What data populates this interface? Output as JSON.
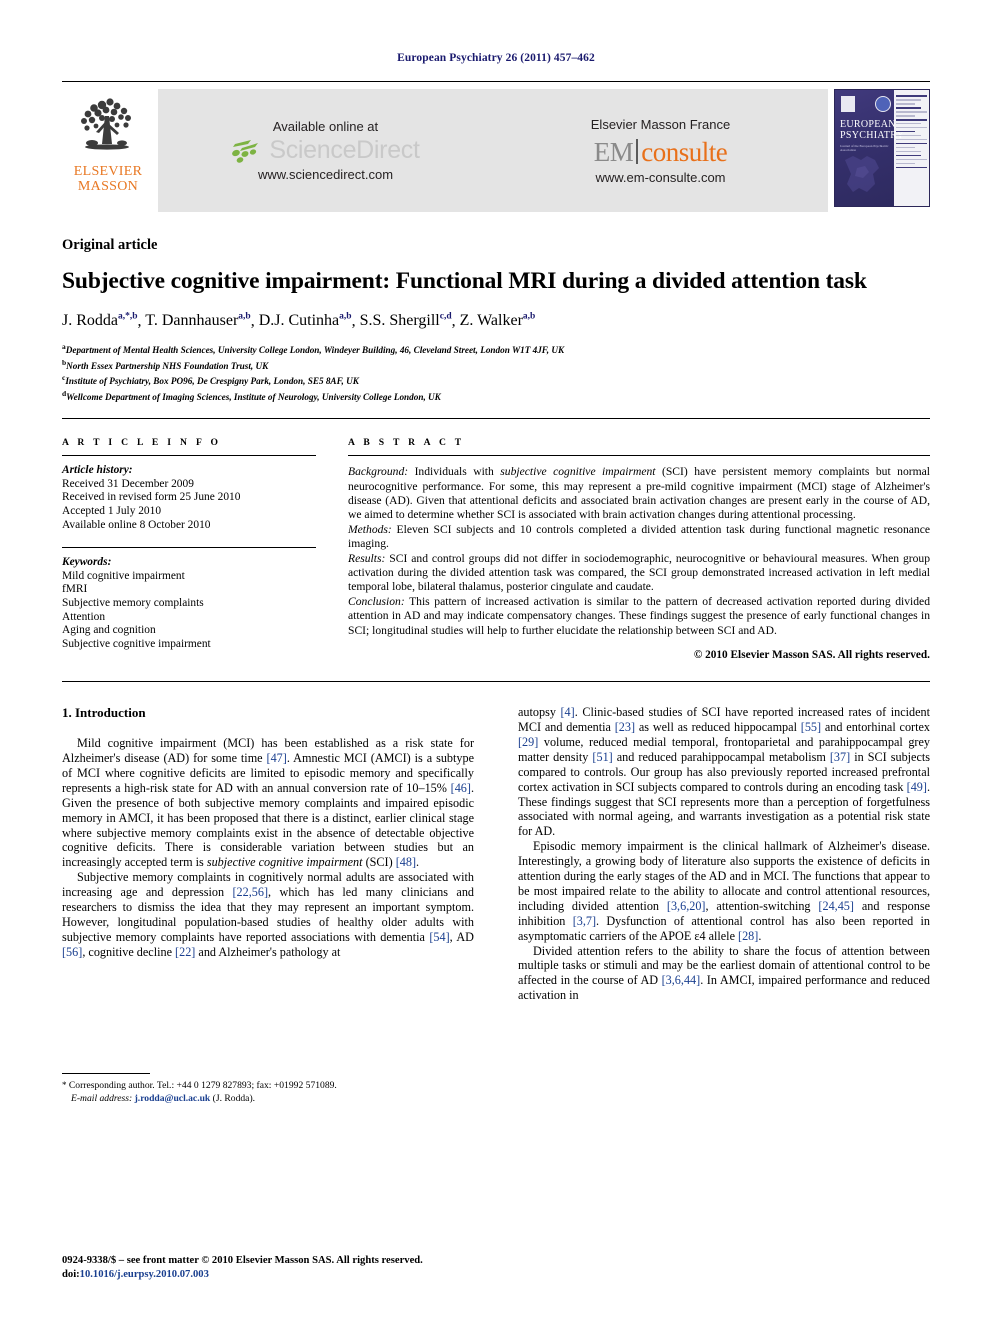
{
  "running_head": "European Psychiatry 26 (2011) 457–462",
  "masthead": {
    "elsevier": {
      "line1": "ELSEVIER",
      "line2": "MASSON",
      "logo_color": "#E87722",
      "icon": "tree-icon"
    },
    "sciencedirect": {
      "available_text": "Available online at",
      "wordmark": "ScienceDirect",
      "url": "www.sciencedirect.com",
      "accent_color": "#7DB343"
    },
    "emconsulte": {
      "publisher": "Elsevier Masson France",
      "wordmark_left": "EM",
      "wordmark_right": "consulte",
      "url": "www.em-consulte.com",
      "accent_color": "#E8701A"
    },
    "cover": {
      "title_line1": "EUROPEAN",
      "title_line2": "PSYCHIATRY",
      "subtitle": "Journal of the European Psychiatric Association",
      "background_color": "#3a3470"
    }
  },
  "article": {
    "type": "Original article",
    "title": "Subjective cognitive impairment: Functional MRI during a divided attention task",
    "authors": [
      {
        "name": "J. Rodda",
        "sup": "a,*,b"
      },
      {
        "name": "T. Dannhauser",
        "sup": "a,b"
      },
      {
        "name": "D.J. Cutinha",
        "sup": "a,b"
      },
      {
        "name": "S.S. Shergill",
        "sup": "c,d"
      },
      {
        "name": "Z. Walker",
        "sup": "a,b"
      }
    ],
    "affiliations": [
      {
        "mark": "a",
        "text": "Department of Mental Health Sciences, University College London, Windeyer Building, 46, Cleveland Street, London W1T 4JF, UK"
      },
      {
        "mark": "b",
        "text": "North Essex Partnership NHS Foundation Trust, UK"
      },
      {
        "mark": "c",
        "text": "Institute of Psychiatry, Box PO96, De Crespigny Park, London, SE5 8AF, UK"
      },
      {
        "mark": "d",
        "text": "Wellcome Department of Imaging Sciences, Institute of Neurology, University College London, UK"
      }
    ]
  },
  "article_info": {
    "heading": "A R T I C L E   I N F O",
    "history_label": "Article history:",
    "history": [
      "Received 31 December 2009",
      "Received in revised form 25 June 2010",
      "Accepted 1 July 2010",
      "Available online 8 October 2010"
    ],
    "keywords_label": "Keywords:",
    "keywords": [
      "Mild cognitive impairment",
      "fMRI",
      "Subjective memory complaints",
      "Attention",
      "Aging and cognition",
      "Subjective cognitive impairment"
    ]
  },
  "abstract": {
    "heading": "A B S T R A C T",
    "sections": [
      {
        "label": "Background:",
        "text_before_italic": " Individuals with ",
        "italic": "subjective cognitive impairment",
        "text_after_italic": " (SCI) have persistent memory complaints but normal neurocognitive performance. For some, this may represent a pre-mild cognitive impairment (MCI) stage of Alzheimer's disease (AD). Given that attentional deficits and associated brain activation changes are present early in the course of AD, we aimed to determine whether SCI is associated with brain activation changes during attentional processing."
      },
      {
        "label": "Methods:",
        "text": " Eleven SCI subjects and 10 controls completed a divided attention task during functional magnetic resonance imaging."
      },
      {
        "label": "Results:",
        "text": " SCI and control groups did not differ in sociodemographic, neurocognitive or behavioural measures. When group activation during the divided attention task was compared, the SCI group demonstrated increased activation in left medial temporal lobe, bilateral thalamus, posterior cingulate and caudate."
      },
      {
        "label": "Conclusion:",
        "text": " This pattern of increased activation is similar to the pattern of decreased activation reported during divided attention in AD and may indicate compensatory changes. These findings suggest the presence of early functional changes in SCI; longitudinal studies will help to further elucidate the relationship between SCI and AD."
      }
    ],
    "copyright": "© 2010 Elsevier Masson SAS. All rights reserved."
  },
  "body": {
    "section_number_title": "1. Introduction",
    "left_paragraphs": [
      "Mild cognitive impairment (MCI) has been established as a risk state for Alzheimer's disease (AD) for some time [47]. Amnestic MCI (AMCI) is a subtype of MCI where cognitive deficits are limited to episodic memory and specifically represents a high-risk state for AD with an annual conversion rate of 10–15% [46]. Given the presence of both subjective memory complaints and impaired episodic memory in AMCI, it has been proposed that there is a distinct, earlier clinical stage where subjective memory complaints exist in the absence of detectable objective cognitive deficits. There is considerable variation between studies but an increasingly accepted term is subjective cognitive impairment (SCI) [48].",
      "Subjective memory complaints in cognitively normal adults are associated with increasing age and depression [22,56], which has led many clinicians and researchers to dismiss the idea that they may represent an important symptom. However, longitudinal population-based studies of healthy older adults with subjective memory complaints have reported associations with dementia [54], AD [56], cognitive decline [22] and Alzheimer's pathology at"
    ],
    "right_paragraphs": [
      "autopsy [4]. Clinic-based studies of SCI have reported increased rates of incident MCI and dementia [23] as well as reduced hippocampal [55] and entorhinal cortex [29] volume, reduced medial temporal, frontoparietal and parahippocampal grey matter density [51] and reduced parahippocampal metabolism [37] in SCI subjects compared to controls. Our group has also previously reported increased prefrontal cortex activation in SCI subjects compared to controls during an encoding task [49]. These findings suggest that SCI represents more than a perception of forgetfulness associated with normal ageing, and warrants investigation as a potential risk state for AD.",
      "Episodic memory impairment is the clinical hallmark of Alzheimer's disease. Interestingly, a growing body of literature also supports the existence of deficits in attention during the early stages of the AD and in MCI. The functions that appear to be most impaired relate to the ability to allocate and control attentional resources, including divided attention [3,6,20], attention-switching [24,45] and response inhibition [3,7]. Dysfunction of attentional control has also been reported in asymptomatic carriers of the APOE ε4 allele [28].",
      "Divided attention refers to the ability to share the focus of attention between multiple tasks or stimuli and may be the earliest domain of attentional control to be affected in the course of AD [3,6,44]. In AMCI, impaired performance and reduced activation in"
    ]
  },
  "footnote": {
    "marker": "*",
    "text": "Corresponding author. Tel.: +44 0 1279 827893; fax: +01992 571089.",
    "email_label": "E-mail address:",
    "email": "j.rodda@ucl.ac.uk",
    "email_suffix": "(J. Rodda)."
  },
  "page_footer": {
    "issn_line": "0924-9338/$ – see front matter © 2010 Elsevier Masson SAS. All rights reserved.",
    "doi_label": "doi:",
    "doi": "10.1016/j.eurpsy.2010.07.003"
  }
}
